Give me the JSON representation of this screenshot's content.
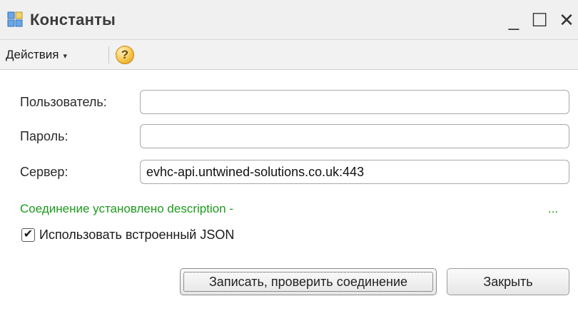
{
  "window": {
    "title": "Константы",
    "icon": "app-grid-icon",
    "controls": {
      "minimize": "_",
      "maximize": "☐",
      "close": "✕"
    }
  },
  "toolbar": {
    "actions_label": "Действия",
    "actions_caret": "▾",
    "help_symbol": "?"
  },
  "form": {
    "user_label": "Пользователь:",
    "user_value": "",
    "password_label": "Пароль:",
    "password_value": "",
    "server_label": "Сервер:",
    "server_value": "evhc-api.untwined-solutions.co.uk:443"
  },
  "status": {
    "text": "Соединение установлено description -",
    "ellipsis": "...",
    "color": "#1e9a1e"
  },
  "option": {
    "use_builtin_json_label": "Использовать встроенный JSON",
    "checked": true
  },
  "buttons": {
    "save_label": "Записать, проверить соединение",
    "close_label": "Закрыть"
  }
}
